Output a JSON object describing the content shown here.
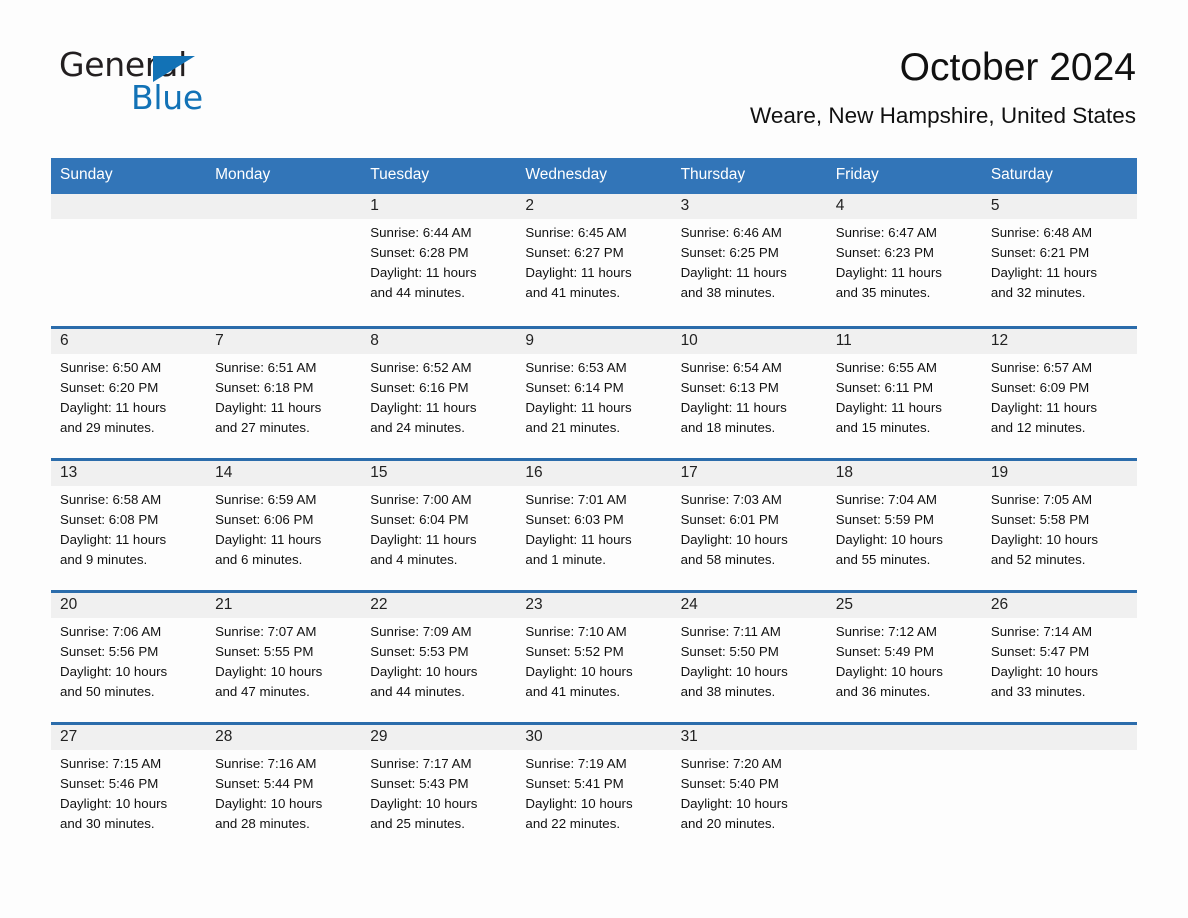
{
  "brand": {
    "name_part1": "General",
    "name_part2": "Blue",
    "logo_icon": "triangle-flag-icon",
    "accent_color": "#1272b6"
  },
  "header": {
    "month_title": "October 2024",
    "location": "Weare, New Hampshire, United States"
  },
  "calendar": {
    "header_color": "#3275b8",
    "divider_color": "#2b6cab",
    "band_color": "#f0f0f0",
    "weekday_names": [
      "Sunday",
      "Monday",
      "Tuesday",
      "Wednesday",
      "Thursday",
      "Friday",
      "Saturday"
    ],
    "weeks": [
      [
        {
          "day": "",
          "sunrise": "",
          "sunset": "",
          "daylight": "",
          "empty": true
        },
        {
          "day": "",
          "sunrise": "",
          "sunset": "",
          "daylight": "",
          "empty": true
        },
        {
          "day": "1",
          "sunrise": "Sunrise: 6:44 AM",
          "sunset": "Sunset: 6:28 PM",
          "daylight": "Daylight: 11 hours and 44 minutes."
        },
        {
          "day": "2",
          "sunrise": "Sunrise: 6:45 AM",
          "sunset": "Sunset: 6:27 PM",
          "daylight": "Daylight: 11 hours and 41 minutes."
        },
        {
          "day": "3",
          "sunrise": "Sunrise: 6:46 AM",
          "sunset": "Sunset: 6:25 PM",
          "daylight": "Daylight: 11 hours and 38 minutes."
        },
        {
          "day": "4",
          "sunrise": "Sunrise: 6:47 AM",
          "sunset": "Sunset: 6:23 PM",
          "daylight": "Daylight: 11 hours and 35 minutes."
        },
        {
          "day": "5",
          "sunrise": "Sunrise: 6:48 AM",
          "sunset": "Sunset: 6:21 PM",
          "daylight": "Daylight: 11 hours and 32 minutes."
        }
      ],
      [
        {
          "day": "6",
          "sunrise": "Sunrise: 6:50 AM",
          "sunset": "Sunset: 6:20 PM",
          "daylight": "Daylight: 11 hours and 29 minutes."
        },
        {
          "day": "7",
          "sunrise": "Sunrise: 6:51 AM",
          "sunset": "Sunset: 6:18 PM",
          "daylight": "Daylight: 11 hours and 27 minutes."
        },
        {
          "day": "8",
          "sunrise": "Sunrise: 6:52 AM",
          "sunset": "Sunset: 6:16 PM",
          "daylight": "Daylight: 11 hours and 24 minutes."
        },
        {
          "day": "9",
          "sunrise": "Sunrise: 6:53 AM",
          "sunset": "Sunset: 6:14 PM",
          "daylight": "Daylight: 11 hours and 21 minutes."
        },
        {
          "day": "10",
          "sunrise": "Sunrise: 6:54 AM",
          "sunset": "Sunset: 6:13 PM",
          "daylight": "Daylight: 11 hours and 18 minutes."
        },
        {
          "day": "11",
          "sunrise": "Sunrise: 6:55 AM",
          "sunset": "Sunset: 6:11 PM",
          "daylight": "Daylight: 11 hours and 15 minutes."
        },
        {
          "day": "12",
          "sunrise": "Sunrise: 6:57 AM",
          "sunset": "Sunset: 6:09 PM",
          "daylight": "Daylight: 11 hours and 12 minutes."
        }
      ],
      [
        {
          "day": "13",
          "sunrise": "Sunrise: 6:58 AM",
          "sunset": "Sunset: 6:08 PM",
          "daylight": "Daylight: 11 hours and 9 minutes."
        },
        {
          "day": "14",
          "sunrise": "Sunrise: 6:59 AM",
          "sunset": "Sunset: 6:06 PM",
          "daylight": "Daylight: 11 hours and 6 minutes."
        },
        {
          "day": "15",
          "sunrise": "Sunrise: 7:00 AM",
          "sunset": "Sunset: 6:04 PM",
          "daylight": "Daylight: 11 hours and 4 minutes."
        },
        {
          "day": "16",
          "sunrise": "Sunrise: 7:01 AM",
          "sunset": "Sunset: 6:03 PM",
          "daylight": "Daylight: 11 hours and 1 minute."
        },
        {
          "day": "17",
          "sunrise": "Sunrise: 7:03 AM",
          "sunset": "Sunset: 6:01 PM",
          "daylight": "Daylight: 10 hours and 58 minutes."
        },
        {
          "day": "18",
          "sunrise": "Sunrise: 7:04 AM",
          "sunset": "Sunset: 5:59 PM",
          "daylight": "Daylight: 10 hours and 55 minutes."
        },
        {
          "day": "19",
          "sunrise": "Sunrise: 7:05 AM",
          "sunset": "Sunset: 5:58 PM",
          "daylight": "Daylight: 10 hours and 52 minutes."
        }
      ],
      [
        {
          "day": "20",
          "sunrise": "Sunrise: 7:06 AM",
          "sunset": "Sunset: 5:56 PM",
          "daylight": "Daylight: 10 hours and 50 minutes."
        },
        {
          "day": "21",
          "sunrise": "Sunrise: 7:07 AM",
          "sunset": "Sunset: 5:55 PM",
          "daylight": "Daylight: 10 hours and 47 minutes."
        },
        {
          "day": "22",
          "sunrise": "Sunrise: 7:09 AM",
          "sunset": "Sunset: 5:53 PM",
          "daylight": "Daylight: 10 hours and 44 minutes."
        },
        {
          "day": "23",
          "sunrise": "Sunrise: 7:10 AM",
          "sunset": "Sunset: 5:52 PM",
          "daylight": "Daylight: 10 hours and 41 minutes."
        },
        {
          "day": "24",
          "sunrise": "Sunrise: 7:11 AM",
          "sunset": "Sunset: 5:50 PM",
          "daylight": "Daylight: 10 hours and 38 minutes."
        },
        {
          "day": "25",
          "sunrise": "Sunrise: 7:12 AM",
          "sunset": "Sunset: 5:49 PM",
          "daylight": "Daylight: 10 hours and 36 minutes."
        },
        {
          "day": "26",
          "sunrise": "Sunrise: 7:14 AM",
          "sunset": "Sunset: 5:47 PM",
          "daylight": "Daylight: 10 hours and 33 minutes."
        }
      ],
      [
        {
          "day": "27",
          "sunrise": "Sunrise: 7:15 AM",
          "sunset": "Sunset: 5:46 PM",
          "daylight": "Daylight: 10 hours and 30 minutes."
        },
        {
          "day": "28",
          "sunrise": "Sunrise: 7:16 AM",
          "sunset": "Sunset: 5:44 PM",
          "daylight": "Daylight: 10 hours and 28 minutes."
        },
        {
          "day": "29",
          "sunrise": "Sunrise: 7:17 AM",
          "sunset": "Sunset: 5:43 PM",
          "daylight": "Daylight: 10 hours and 25 minutes."
        },
        {
          "day": "30",
          "sunrise": "Sunrise: 7:19 AM",
          "sunset": "Sunset: 5:41 PM",
          "daylight": "Daylight: 10 hours and 22 minutes."
        },
        {
          "day": "31",
          "sunrise": "Sunrise: 7:20 AM",
          "sunset": "Sunset: 5:40 PM",
          "daylight": "Daylight: 10 hours and 20 minutes."
        },
        {
          "day": "",
          "sunrise": "",
          "sunset": "",
          "daylight": "",
          "empty": true
        },
        {
          "day": "",
          "sunrise": "",
          "sunset": "",
          "daylight": "",
          "empty": true
        }
      ]
    ]
  }
}
